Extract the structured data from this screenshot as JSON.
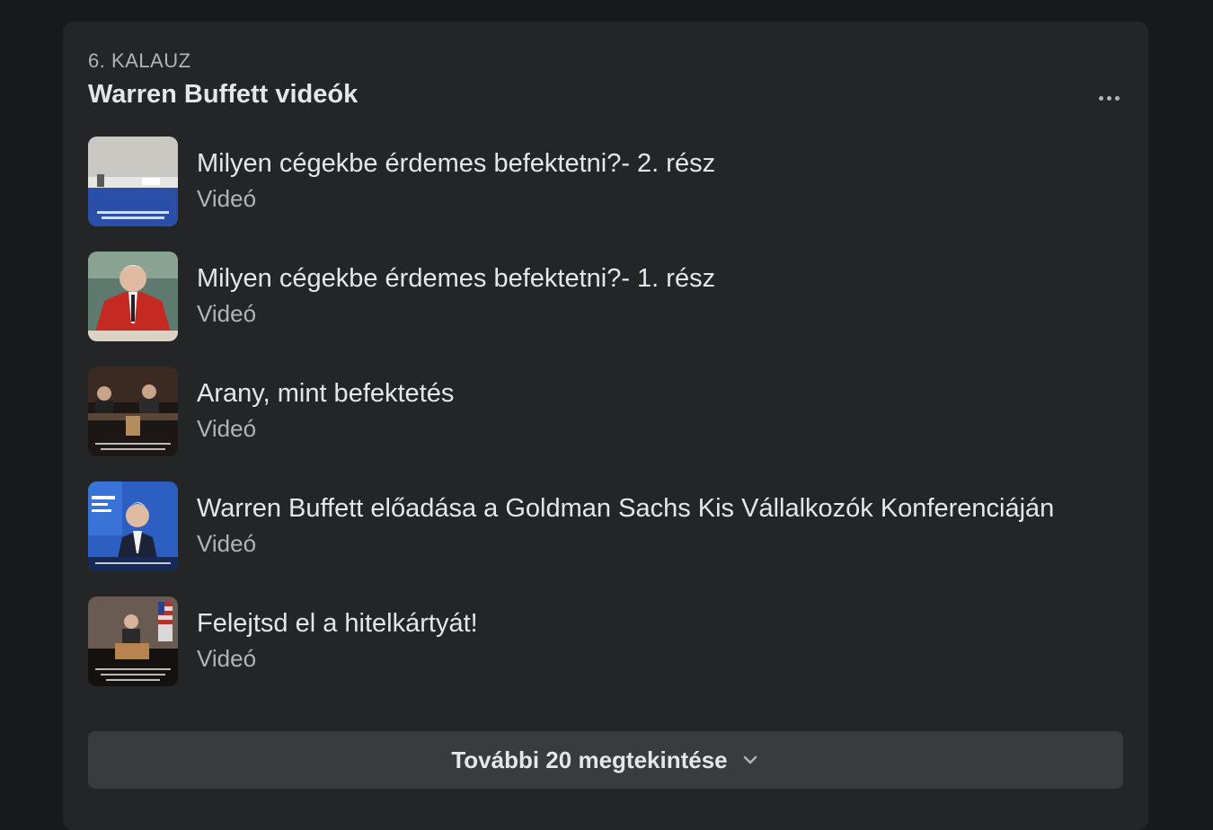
{
  "guide": {
    "label": "6. KALAUZ",
    "title": "Warren Buffett videók",
    "more_icon": "more-horizontal-icon"
  },
  "videos": [
    {
      "title": "Milyen cégekbe érdemes befektetni?- 2. rész",
      "type": "Videó"
    },
    {
      "title": "Milyen cégekbe érdemes befektetni?- 1. rész",
      "type": "Videó"
    },
    {
      "title": "Arany, mint befektetés",
      "type": "Videó"
    },
    {
      "title": "Warren Buffett előadása a Goldman Sachs Kis Vállalkozók Konferenciáján",
      "type": "Videó"
    },
    {
      "title": "Felejtsd el a hitelkártyát!",
      "type": "Videó"
    }
  ],
  "see_more": {
    "label": "További 20 megtekintése",
    "icon": "chevron-down-icon"
  },
  "colors": {
    "page_bg": "#18191a",
    "card_bg": "#242526",
    "button_bg": "#3a3b3c",
    "primary_text": "#e4e6eb",
    "secondary_text": "#b0b3b8"
  }
}
